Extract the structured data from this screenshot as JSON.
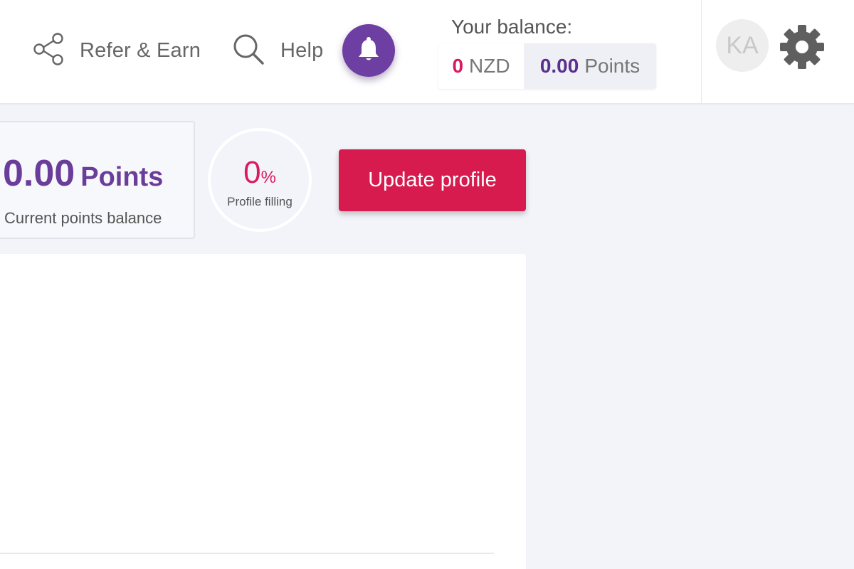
{
  "header": {
    "refer_label": "Refer & Earn",
    "help_label": "Help",
    "balance": {
      "label": "Your balance:",
      "nzd_value": "0",
      "nzd_unit": "NZD",
      "points_value": "0.00",
      "points_unit": "Points"
    },
    "avatar_initials": "KA"
  },
  "summary": {
    "points_value": "0.00",
    "points_unit": "Points",
    "points_caption": "Current points balance",
    "profile_fill_percent": "0",
    "profile_fill_sign": "%",
    "profile_fill_caption": "Profile filling",
    "update_button_label": "Update profile"
  },
  "colors": {
    "brand_purple": "#6a3d9a",
    "accent_red": "#d81b4f",
    "background": "#f3f4f9"
  },
  "icons": [
    "share-icon",
    "search-icon",
    "bell-icon",
    "gear-icon"
  ]
}
